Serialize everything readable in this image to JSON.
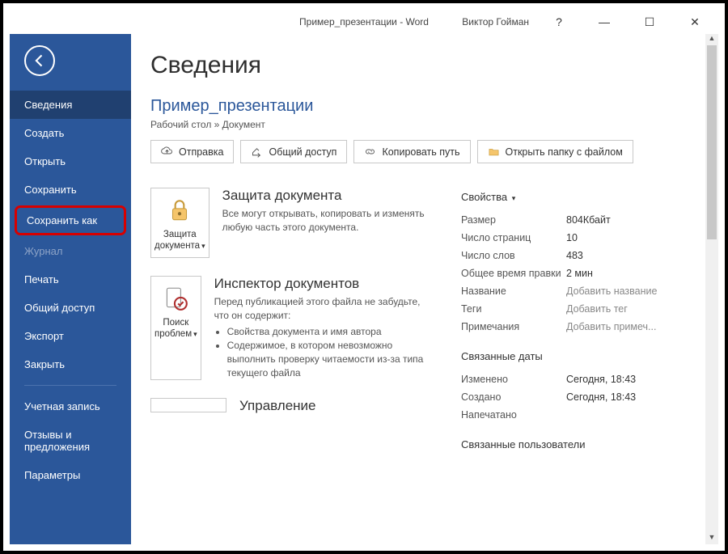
{
  "titlebar": {
    "title": "Пример_презентации  -  Word",
    "user": "Виктор Гойман",
    "help": "?",
    "min": "—",
    "max": "☐",
    "close": "✕"
  },
  "sidebar": {
    "items": [
      {
        "label": "Сведения",
        "sel": true
      },
      {
        "label": "Создать"
      },
      {
        "label": "Открыть"
      },
      {
        "label": "Сохранить"
      },
      {
        "label": "Сохранить как",
        "highlight": true
      },
      {
        "label": "Журнал",
        "disabled": true
      },
      {
        "label": "Печать"
      },
      {
        "label": "Общий доступ"
      },
      {
        "label": "Экспорт"
      },
      {
        "label": "Закрыть"
      },
      {
        "sep": true
      },
      {
        "label": "Учетная запись"
      },
      {
        "label": "Отзывы и предложения"
      },
      {
        "label": "Параметры"
      }
    ]
  },
  "main": {
    "heading": "Сведения",
    "doc_title": "Пример_презентации",
    "breadcrumb": "Рабочий стол » Документ",
    "toolbar": {
      "send": "Отправка",
      "share": "Общий доступ",
      "copy_path": "Копировать путь",
      "open_folder": "Открыть папку с файлом"
    },
    "sections": {
      "protect": {
        "btn": "Защита документа",
        "title": "Защита документа",
        "desc": "Все могут открывать, копировать и изменять любую часть этого документа."
      },
      "inspect": {
        "btn": "Поиск проблем",
        "title": "Инспектор документов",
        "desc": "Перед публикацией этого файла не забудьте, что он содержит:",
        "b1": "Свойства документа и имя автора",
        "b2": "Содержимое, в котором невозможно выполнить проверку читаемости из-за типа текущего файла"
      },
      "manage": {
        "title": "Управление"
      }
    },
    "props": {
      "header": "Свойства",
      "size_k": "Размер",
      "size_v": "804Кбайт",
      "pages_k": "Число страниц",
      "pages_v": "10",
      "words_k": "Число слов",
      "words_v": "483",
      "edit_k": "Общее время правки",
      "edit_v": "2 мин",
      "title_k": "Название",
      "title_v": "Добавить название",
      "tags_k": "Теги",
      "tags_v": "Добавить тег",
      "notes_k": "Примечания",
      "notes_v": "Добавить примеч...",
      "dates_header": "Связанные даты",
      "mod_k": "Изменено",
      "mod_v": "Сегодня, 18:43",
      "cre_k": "Создано",
      "cre_v": "Сегодня, 18:43",
      "prn_k": "Напечатано",
      "users_header": "Связанные пользователи"
    }
  }
}
